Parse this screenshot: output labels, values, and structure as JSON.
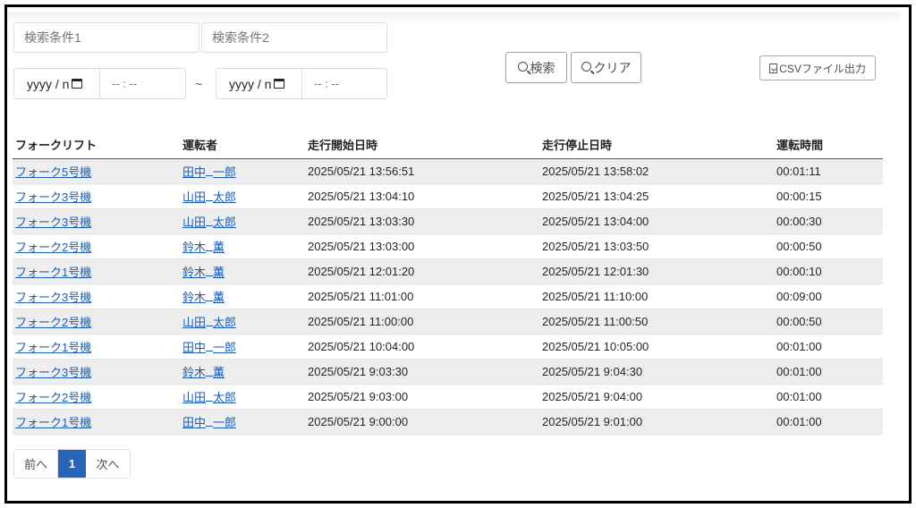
{
  "search": {
    "cond1_placeholder": "検索条件1",
    "cond2_placeholder": "検索条件2",
    "date_placeholder": "yyyy / n",
    "time_placeholder": "-- : --",
    "tilde": "~"
  },
  "buttons": {
    "search": "検索",
    "clear": "クリア",
    "csv": "CSVファイル出力"
  },
  "table": {
    "headers": [
      "フォークリフト",
      "運転者",
      "走行開始日時",
      "走行停止日時",
      "運転時間"
    ],
    "rows": [
      {
        "forklift": "フォーク5号機",
        "driver_last": "田中",
        "driver_first": "一郎",
        "start": "2025/05/21 13:56:51",
        "stop": "2025/05/21 13:58:02",
        "duration": "00:01:11"
      },
      {
        "forklift": "フォーク3号機",
        "driver_last": "山田",
        "driver_first": "太郎",
        "start": "2025/05/21 13:04:10",
        "stop": "2025/05/21 13:04:25",
        "duration": "00:00:15"
      },
      {
        "forklift": "フォーク3号機",
        "driver_last": "山田",
        "driver_first": "太郎",
        "start": "2025/05/21 13:03:30",
        "stop": "2025/05/21 13:04:00",
        "duration": "00:00:30"
      },
      {
        "forklift": "フォーク2号機",
        "driver_last": "鈴木",
        "driver_first": "薫",
        "start": "2025/05/21 13:03:00",
        "stop": "2025/05/21 13:03:50",
        "duration": "00:00:50"
      },
      {
        "forklift": "フォーク1号機",
        "driver_last": "鈴木",
        "driver_first": "薫",
        "start": "2025/05/21 12:01:20",
        "stop": "2025/05/21 12:01:30",
        "duration": "00:00:10"
      },
      {
        "forklift": "フォーク3号機",
        "driver_last": "鈴木",
        "driver_first": "薫",
        "start": "2025/05/21 11:01:00",
        "stop": "2025/05/21 11:10:00",
        "duration": "00:09:00"
      },
      {
        "forklift": "フォーク2号機",
        "driver_last": "山田",
        "driver_first": "太郎",
        "start": "2025/05/21 11:00:00",
        "stop": "2025/05/21 11:00:50",
        "duration": "00:00:50"
      },
      {
        "forklift": "フォーク1号機",
        "driver_last": "田中",
        "driver_first": "一郎",
        "start": "2025/05/21 10:04:00",
        "stop": "2025/05/21 10:05:00",
        "duration": "00:01:00"
      },
      {
        "forklift": "フォーク3号機",
        "driver_last": "鈴木",
        "driver_first": "薫",
        "start": "2025/05/21 9:03:30",
        "stop": "2025/05/21 9:04:30",
        "duration": "00:01:00"
      },
      {
        "forklift": "フォーク2号機",
        "driver_last": "山田",
        "driver_first": "太郎",
        "start": "2025/05/21 9:03:00",
        "stop": "2025/05/21 9:04:00",
        "duration": "00:01:00"
      },
      {
        "forklift": "フォーク1号機",
        "driver_last": "田中",
        "driver_first": "一郎",
        "start": "2025/05/21 9:00:00",
        "stop": "2025/05/21 9:01:00",
        "duration": "00:01:00"
      }
    ]
  },
  "pagination": {
    "prev": "前へ",
    "current": "1",
    "next": "次へ"
  },
  "colors": {
    "link": "#1a5fb4",
    "active_page": "#2765b8",
    "stripe": "#eeeeee"
  },
  "icons": [
    "calendar-icon",
    "search-icon",
    "file-download-icon"
  ]
}
